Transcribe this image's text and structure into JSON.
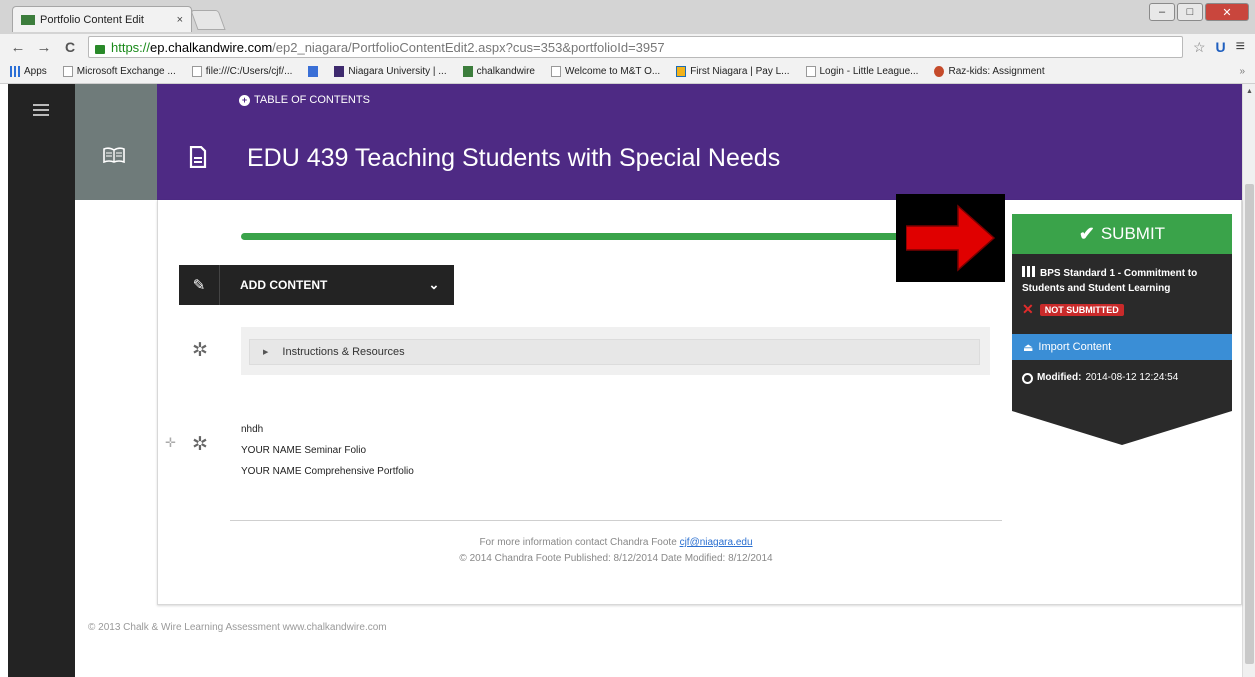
{
  "browser": {
    "tab_title": "Portfolio Content Edit",
    "tab_close": "×",
    "url_scheme": "https://",
    "url_host": "ep.chalkandwire.com",
    "url_path": "/ep2_niagara/PortfolioContentEdit2.aspx?cus=353&portfolioId=3957",
    "back_glyph": "←",
    "forward_glyph": "→",
    "reload_glyph": "C",
    "star_glyph": "☆",
    "ext_glyph": "U",
    "menu_glyph": "≡",
    "bookmarks": [
      {
        "label": "Apps",
        "icon": "apps-icon"
      },
      {
        "label": "Microsoft Exchange ...",
        "icon": "page-icon"
      },
      {
        "label": "file:///C:/Users/cjf/...",
        "icon": "page-icon"
      },
      {
        "label": "",
        "icon": "google-icon"
      },
      {
        "label": "Niagara University | ...",
        "icon": "niagara-icon"
      },
      {
        "label": "chalkandwire",
        "icon": "chalkandwire-icon"
      },
      {
        "label": "Welcome to M&T O...",
        "icon": "page-icon"
      },
      {
        "label": "First Niagara | Pay L...",
        "icon": "first-niagara-icon"
      },
      {
        "label": "Login - Little League...",
        "icon": "page-icon"
      },
      {
        "label": "Raz-kids: Assignment",
        "icon": "razkids-icon"
      }
    ],
    "bookmarks_more": "»"
  },
  "header": {
    "toc_label": "TABLE OF CONTENTS",
    "title": "EDU 439 Teaching Students with Special Needs"
  },
  "content": {
    "add_content_label": "ADD CONTENT",
    "instructions_label": "Instructions & Resources",
    "items": [
      "nhdh",
      "YOUR NAME Seminar Folio",
      "YOUR NAME Comprehensive Portfolio"
    ],
    "footer_contact_prefix": "For more information contact Chandra Foote",
    "footer_email": "cjf@niagara.edu",
    "footer_published": "© 2014 Chandra Foote Published: 8/12/2014 Date Modified: 8/12/2014"
  },
  "sidebar_right": {
    "submit_label": "SUBMIT",
    "standard_title": "BPS Standard 1 - Commitment to Students and Student Learning",
    "status": "NOT SUBMITTED",
    "import_label": "Import Content",
    "modified_label": "Modified:",
    "modified_value": "2014-08-12 12:24:54"
  },
  "copyright": "© 2013 Chalk & Wire Learning Assessment   www.chalkandwire.com",
  "colors": {
    "header_purple": "#4e2a84",
    "submit_green": "#3aa34a",
    "import_blue": "#3a8ed6",
    "status_red": "#c92a2a",
    "arrow_red": "#e00000"
  }
}
